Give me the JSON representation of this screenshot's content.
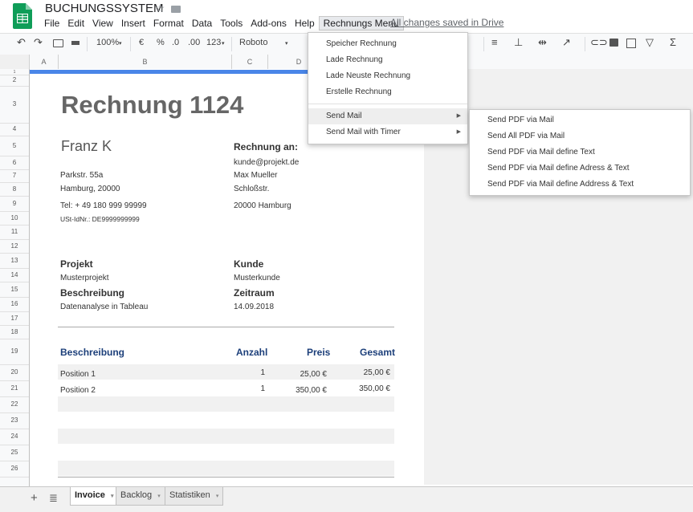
{
  "app": {
    "doc_title": "BUCHUNGSSYSTEM",
    "save_status": "All changes saved in Drive"
  },
  "menubar": [
    "File",
    "Edit",
    "View",
    "Insert",
    "Format",
    "Data",
    "Tools",
    "Add-ons",
    "Help",
    "Rechnungs Menu"
  ],
  "toolbar": {
    "zoom": "100%",
    "currency": "€",
    "percent": "%",
    "dec_less": ".0",
    "dec_more": ".00",
    "format_more": "123",
    "font": "Roboto"
  },
  "columns": [
    "A",
    "B",
    "C",
    "D"
  ],
  "rows": [
    "1",
    "2",
    "3",
    "4",
    "5",
    "6",
    "7",
    "8",
    "9",
    "10",
    "11",
    "12",
    "13",
    "14",
    "15",
    "16",
    "17",
    "18",
    "19",
    "20",
    "21",
    "22",
    "23",
    "24",
    "25",
    "26"
  ],
  "invoice": {
    "title": "Rechnung 1124",
    "sender_name": "Franz K",
    "sender_street": "Parkstr. 55a",
    "sender_city": "Hamburg, 20000",
    "sender_tel": "Tel: + 49 180 999 99999",
    "sender_vat": "USt-IdNr.: DE9999999999",
    "bill_to_label": "Rechnung an:",
    "client_email": "kunde@projekt.de",
    "client_name": "Max Mueller",
    "client_street": "Schloßstr.",
    "client_city": "20000 Hamburg",
    "project_label": "Projekt",
    "project_value": "Musterprojekt",
    "customer_label": "Kunde",
    "customer_value": "Musterkunde",
    "description_label": "Beschreibung",
    "description_value": "Datenanalyse in Tableau",
    "period_label": "Zeitraum",
    "period_value": "14.09.2018",
    "table_headers": {
      "description": "Beschreibung",
      "quantity": "Anzahl",
      "price": "Preis",
      "total": "Gesamt"
    },
    "items": [
      {
        "description": "Position 1",
        "quantity": "1",
        "price": "25,00 €",
        "total": "25,00 €"
      },
      {
        "description": "Position 2",
        "quantity": "1",
        "price": "350,00 €",
        "total": "350,00 €"
      }
    ]
  },
  "rechnungs_menu": {
    "items": [
      "Speicher Rechnung",
      "Lade Rechnung",
      "Lade Neuste Rechnung",
      "Erstelle Rechnung"
    ],
    "submenus": [
      "Send Mail",
      "Send Mail with Timer"
    ]
  },
  "send_mail_submenu": [
    "Send PDF via Mail",
    "Send All PDF via Mail",
    "Send PDF via Mail define Text",
    "Send PDF via Mail define Adress & Text",
    "Send PDF via Mail define Address & Text"
  ],
  "sheet_tabs": [
    "Invoice",
    "Backlog",
    "Statistiken"
  ],
  "colors": {
    "accent_blue": "#4a86e8",
    "table_header_blue": "#1c3f7a",
    "sheets_green": "#0f9d58"
  }
}
